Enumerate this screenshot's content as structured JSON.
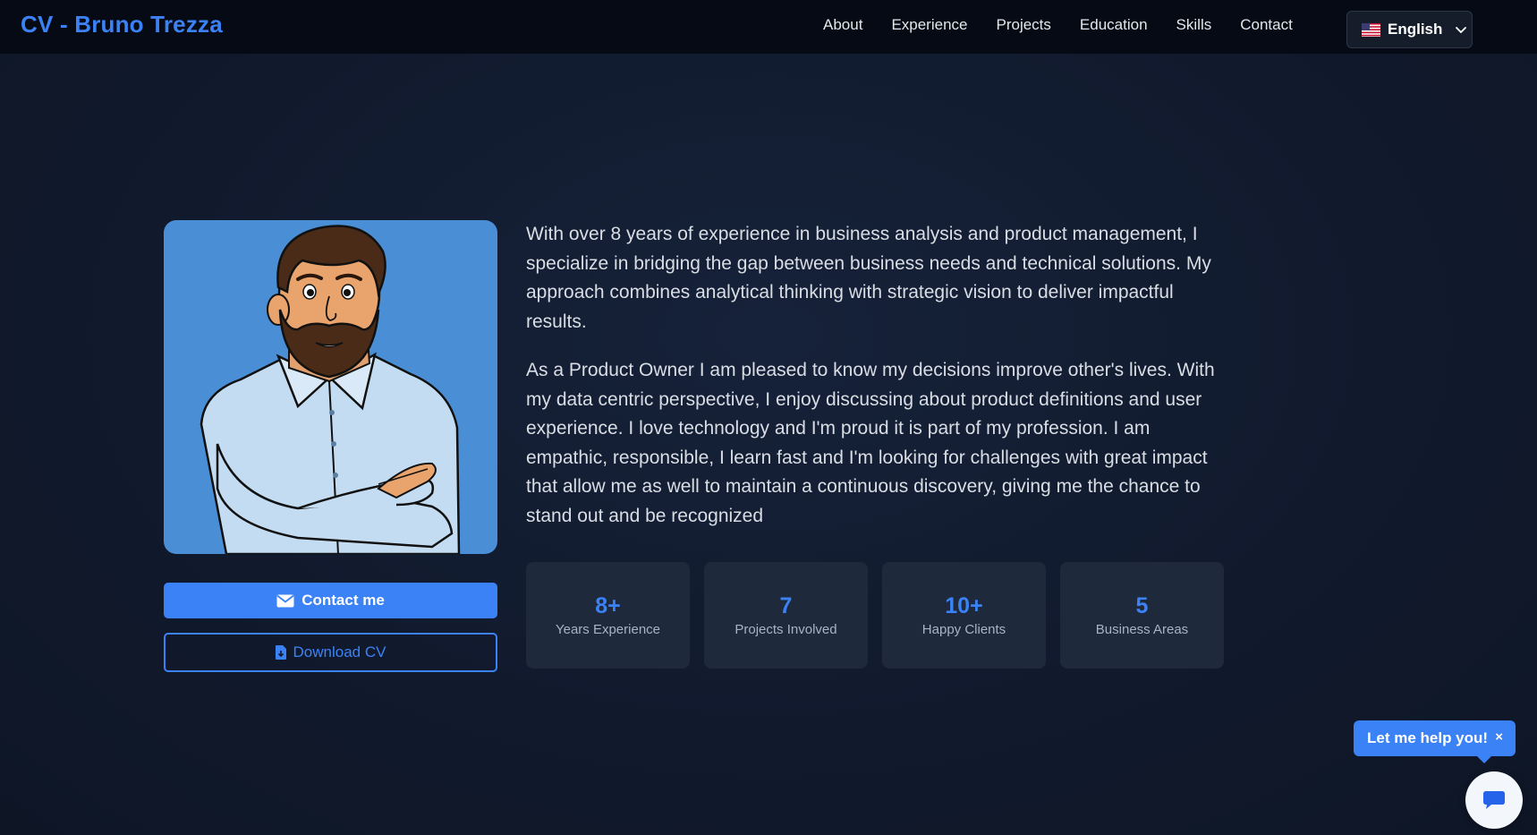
{
  "brand": "CV - Bruno Trezza",
  "nav": {
    "items": [
      "About",
      "Experience",
      "Projects",
      "Education",
      "Skills",
      "Contact"
    ]
  },
  "language": {
    "selected": "English",
    "flag_icon": "us-flag-icon"
  },
  "avatar": {
    "icon": "cartoon-man-portrait"
  },
  "buttons": {
    "contact": "Contact me",
    "download": "Download CV"
  },
  "about": {
    "paragraphs": [
      "With over 8 years of experience in business analysis and product management, I specialize in bridging the gap between business needs and technical solutions. My approach combines analytical thinking with strategic vision to deliver impactful results.",
      "As a Product Owner I am pleased to know my decisions improve other's lives. With my data centric perspective, I enjoy discussing about product definitions and user experience. I love technology and I'm proud it is part of my profession. I am empathic, responsible, I learn fast and I'm looking for challenges with great impact that allow me as well to maintain a continuous discovery, giving me the chance to stand out and be recognized"
    ]
  },
  "stats": [
    {
      "value": "8+",
      "label": "Years Experience"
    },
    {
      "value": "7",
      "label": "Projects Involved"
    },
    {
      "value": "10+",
      "label": "Happy Clients"
    },
    {
      "value": "5",
      "label": "Business Areas"
    }
  ],
  "chat": {
    "bubble": "Let me help you!",
    "close": "×"
  },
  "colors": {
    "accent": "#3b82f6",
    "background": "#111a2d",
    "navbar": "#050a14",
    "card": "#1e293b"
  }
}
